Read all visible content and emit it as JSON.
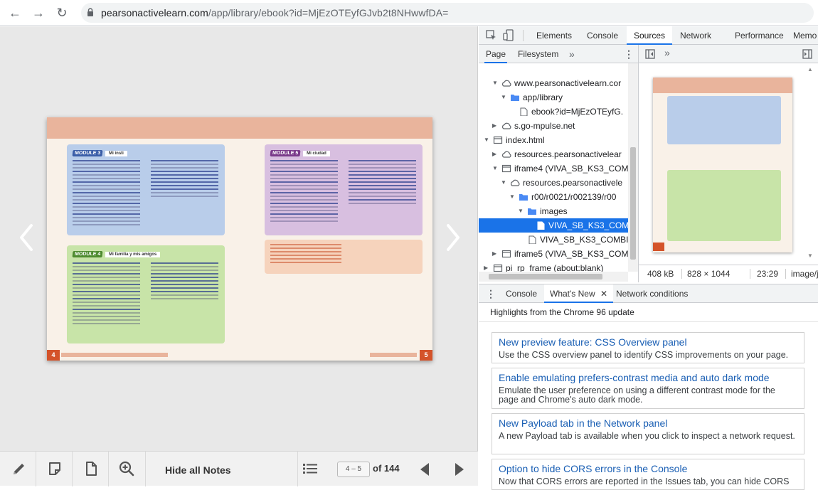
{
  "browser": {
    "url_host": "pearsonactivelearn.com",
    "url_path": "/app/library/ebook?id=MjEzOTEyfGJvb2t8NHwwfDA="
  },
  "viewer": {
    "toolbar": {
      "hide_notes_label": "Hide all Notes",
      "page_value": "4 – 5",
      "of_label": "of 144"
    },
    "spread": {
      "left_page_num": "4",
      "right_page_num": "5",
      "modules": [
        {
          "tag": "MODULE 3",
          "name": "Mi insti",
          "color": "#b9cdea"
        },
        {
          "tag": "MODULE 4",
          "name": "Mi familia y mis amigos",
          "color": "#c8e4a8"
        },
        {
          "tag": "MODULE 5",
          "name": "Mi ciudad",
          "color": "#d8bfe0"
        }
      ]
    }
  },
  "devtools": {
    "tabs": [
      "Elements",
      "Console",
      "Sources",
      "Network",
      "Performance",
      "Memo"
    ],
    "active_tab": "Sources",
    "navigator_tabs": [
      "Page",
      "Filesystem"
    ],
    "tree": [
      {
        "label": "www.pearsonactivelearn.cor",
        "indent": 1,
        "icon": "cloud",
        "tri": "▼"
      },
      {
        "label": "app/library",
        "indent": 2,
        "icon": "folder",
        "tri": "▼"
      },
      {
        "label": "ebook?id=MjEzOTEyfG.",
        "indent": 3,
        "icon": "file",
        "tri": ""
      },
      {
        "label": "s.go-mpulse.net",
        "indent": 1,
        "icon": "cloud",
        "tri": "▶"
      },
      {
        "label": "index.html",
        "indent": 0,
        "icon": "frame",
        "tri": "▼"
      },
      {
        "label": "resources.pearsonactivelear",
        "indent": 1,
        "icon": "cloud",
        "tri": "▶"
      },
      {
        "label": "iframe4 (VIVA_SB_KS3_COM",
        "indent": 1,
        "icon": "frame",
        "tri": "▼"
      },
      {
        "label": "resources.pearsonactivele",
        "indent": 2,
        "icon": "cloud",
        "tri": "▼"
      },
      {
        "label": "r00/r0021/r002139/r00",
        "indent": 3,
        "icon": "folder",
        "tri": "▼"
      },
      {
        "label": "images",
        "indent": 4,
        "icon": "folder",
        "tri": "▼"
      },
      {
        "label": "VIVA_SB_KS3_COM",
        "indent": 5,
        "icon": "file",
        "tri": "",
        "selected": true
      },
      {
        "label": "VIVA_SB_KS3_COMBI",
        "indent": 4,
        "icon": "file",
        "tri": ""
      },
      {
        "label": "iframe5 (VIVA_SB_KS3_COM",
        "indent": 1,
        "icon": "frame",
        "tri": "▶"
      },
      {
        "label": "pi_rp_frame (about:blank)",
        "indent": 0,
        "icon": "frame",
        "tri": "▶"
      }
    ],
    "preview_info": {
      "size": "408 kB",
      "dimensions": "828 × 1044",
      "time": "23:29",
      "mime": "image/jpe"
    },
    "drawer": {
      "tabs": [
        "Console",
        "What's New",
        "Network conditions"
      ],
      "active_tab": "What's New",
      "highlights": "Highlights from the Chrome 96 update",
      "cards": [
        {
          "title": "New preview feature: CSS Overview panel",
          "desc": "Use the CSS overview panel to identify CSS improvements on your page."
        },
        {
          "title": "Enable emulating prefers-contrast media and auto dark mode",
          "desc": "Emulate the user preference on using a different contrast mode for the page and Chrome's auto dark mode."
        },
        {
          "title": "New Payload tab in the Network panel",
          "desc": "A new Payload tab is available when you click to inspect a network request."
        },
        {
          "title": "Option to hide CORS errors in the Console",
          "desc": "Now that CORS errors are reported in the Issues tab, you can hide CORS"
        }
      ]
    }
  }
}
